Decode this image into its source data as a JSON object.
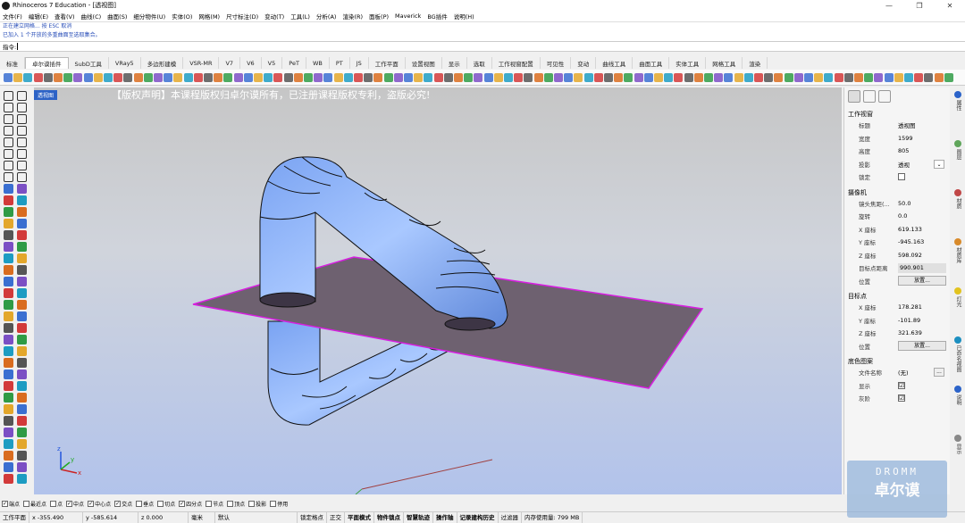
{
  "window": {
    "title": "Rhinoceros 7 Education - [透视图]",
    "controls": [
      "—",
      "❐",
      "✕"
    ]
  },
  "menu": [
    "文件(F)",
    "编辑(E)",
    "查看(V)",
    "曲线(C)",
    "曲面(S)",
    "细分物件(U)",
    "实体(O)",
    "网格(M)",
    "尺寸标注(D)",
    "变动(T)",
    "工具(L)",
    "分析(A)",
    "渲染(R)",
    "面板(P)",
    "Maverick",
    "BG插件",
    "说明(H)"
  ],
  "command_history": [
    "正在建立网格... 按 ESC 取消",
    "已加入 1 个开放的多重曲面至选取集合。"
  ],
  "command_prompt": "指令:",
  "tabs": [
    "标准",
    "卓尔谟插件",
    "SubD工具",
    "VRay5",
    "多边形建模",
    "VSR-MR",
    "V7",
    "V6",
    "V5",
    "PeT",
    "WB",
    "PT",
    "JS",
    "工作平面",
    "设置视图",
    "显示",
    "选取",
    "工作视窗配置",
    "可见性",
    "变动",
    "曲线工具",
    "曲面工具",
    "实体工具",
    "网格工具",
    "渲染"
  ],
  "active_tab": 1,
  "viewport": {
    "label": "透视图",
    "banner": "【版权声明】本课程版权归卓尔谟所有，已注册课程版权专利，盗版必究!",
    "axis": {
      "x": "x",
      "y": "y",
      "z": "z"
    },
    "colors": {
      "pipe": "#7ea8f4",
      "plane": "#6e6170",
      "plane_edge": "#d71ee0"
    }
  },
  "properties": {
    "section_viewport": "工作视窗",
    "rows_viewport": [
      {
        "k": "标题",
        "v": "透视图"
      },
      {
        "k": "宽度",
        "v": "1599"
      },
      {
        "k": "高度",
        "v": "805"
      },
      {
        "k": "投影",
        "v": "透视"
      },
      {
        "k": "锁定",
        "v": ""
      }
    ],
    "section_camera": "摄像机",
    "rows_camera": [
      {
        "k": "镜头焦距(...",
        "v": "50.0"
      },
      {
        "k": "旋转",
        "v": "0.0"
      },
      {
        "k": "X 座标",
        "v": "619.133"
      },
      {
        "k": "Y 座标",
        "v": "-945.163"
      },
      {
        "k": "Z 座标",
        "v": "598.092"
      },
      {
        "k": "目标点距离",
        "v": "990.901"
      },
      {
        "k": "位置",
        "v": "放置..."
      }
    ],
    "section_target": "目标点",
    "rows_target": [
      {
        "k": "X 座标",
        "v": "178.281"
      },
      {
        "k": "Y 座标",
        "v": "-101.89"
      },
      {
        "k": "Z 座标",
        "v": "321.639"
      },
      {
        "k": "位置",
        "v": "放置..."
      }
    ],
    "section_wallpaper": "底色图案",
    "rows_wallpaper": [
      {
        "k": "文件名称",
        "v": "(无)"
      },
      {
        "k": "显示",
        "v": "☑"
      },
      {
        "k": "灰阶",
        "v": "☑"
      }
    ],
    "dropdown_glyph": "⌄",
    "browse_glyph": "..."
  },
  "side_tabs": [
    "属性",
    "图层",
    "材质",
    "材质库",
    "灯光",
    "已命名视图",
    "说明",
    "显示"
  ],
  "osnaps": [
    {
      "label": "端点",
      "on": true
    },
    {
      "label": "最近点",
      "on": false
    },
    {
      "label": "点",
      "on": false
    },
    {
      "label": "中点",
      "on": true
    },
    {
      "label": "中心点",
      "on": true
    },
    {
      "label": "交点",
      "on": true
    },
    {
      "label": "垂点",
      "on": false
    },
    {
      "label": "切点",
      "on": false
    },
    {
      "label": "四分点",
      "on": true
    },
    {
      "label": "节点",
      "on": false
    },
    {
      "label": "顶点",
      "on": false
    },
    {
      "label": "投影",
      "on": false
    },
    {
      "label": "停用",
      "on": false
    }
  ],
  "status": {
    "plane": "工作平面",
    "x": "x -355.490",
    "y": "y -585.614",
    "z": "z 0.000",
    "units": "毫米",
    "layer": "默认",
    "items": [
      "锁定格点",
      "正交",
      "平面模式",
      "物件锁点",
      "智慧轨迹",
      "操作轴",
      "记录建构历史",
      "过滤器",
      "内存使用量: 799 MB"
    ]
  },
  "watermark": {
    "en": "DROMM",
    "cn": "卓尔谟"
  }
}
